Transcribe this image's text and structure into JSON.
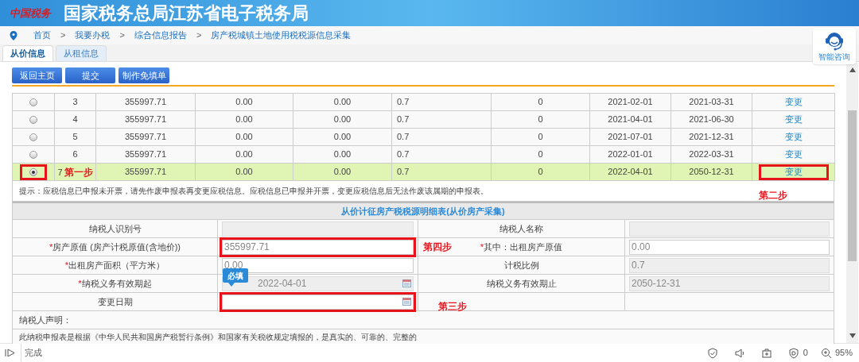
{
  "header": {
    "logo_text": "中国税务",
    "title": "国家税务总局江苏省电子税务局"
  },
  "breadcrumb": [
    {
      "kind": "link",
      "text": "首页"
    },
    {
      "kind": "separator",
      "text": ">"
    },
    {
      "kind": "link",
      "text": "我要办税"
    },
    {
      "kind": "separator",
      "text": ">"
    },
    {
      "kind": "link",
      "text": "综合信息报告"
    },
    {
      "kind": "separator",
      "text": ">"
    },
    {
      "kind": "link",
      "text": "房产税城镇土地使用税税源信息采集"
    }
  ],
  "help": {
    "label": "智能咨询"
  },
  "tabs": [
    {
      "label": "从价信息",
      "selected": true
    },
    {
      "label": "从租信息",
      "selected": false
    }
  ],
  "buttons": [
    "返回主页",
    "提交",
    "制作免填单"
  ],
  "table": {
    "rows": [
      {
        "selected": false,
        "radio_boxed": false,
        "action_boxed": false,
        "cells": [
          "3",
          "355997.71",
          "0.00",
          "0.00",
          "0.7",
          "0",
          "2021-02-01",
          "2021-03-31"
        ],
        "action": "变更"
      },
      {
        "selected": false,
        "radio_boxed": false,
        "action_boxed": false,
        "cells": [
          "4",
          "355997.71",
          "0.00",
          "0.00",
          "0.7",
          "0",
          "2021-04-01",
          "2021-06-30"
        ],
        "action": "变更"
      },
      {
        "selected": false,
        "radio_boxed": false,
        "action_boxed": false,
        "cells": [
          "5",
          "355997.71",
          "0.00",
          "0.00",
          "0.7",
          "0",
          "2021-07-01",
          "2021-12-31"
        ],
        "action": "变更"
      },
      {
        "selected": false,
        "radio_boxed": false,
        "action_boxed": false,
        "cells": [
          "6",
          "355997.71",
          "0.00",
          "0.00",
          "0.7",
          "0",
          "2022-01-01",
          "2022-03-31"
        ],
        "action": "变更"
      },
      {
        "selected": true,
        "radio_boxed": true,
        "action_boxed": true,
        "cells": [
          "7",
          "355997.71",
          "0.00",
          "0.00",
          "0.7",
          "0",
          "2022-04-01",
          "2050-12-31"
        ],
        "action": "变更",
        "step_note": "第一步"
      }
    ],
    "hint": "提示：应税信息已申报未开票，请先作废申报表再变更应税信息。应税信息已申报并开票，变更应税信息后无法作废该属期的申报表。",
    "hint_step": "第二步"
  },
  "form": {
    "title": "从价计征房产税税源明细表(从价房产采集)",
    "rows": [
      [
        {
          "label": "纳税人识别号",
          "readonly": true,
          "boxed": false,
          "kind": "text"
        },
        {
          "label": "纳税人名称",
          "readonly": true,
          "boxed": false,
          "kind": "text"
        }
      ],
      [
        {
          "required_mark": "*",
          "label": "房产原值 (房产计税原值(含地价))",
          "readonly": false,
          "boxed": true,
          "kind": "text",
          "value": "355997.71"
        },
        {
          "required_mark": "*",
          "label": "其中：出租房产原值",
          "readonly": false,
          "boxed": false,
          "kind": "text",
          "value": "0.00",
          "step_note": "第四步"
        }
      ],
      [
        {
          "required_mark": "*",
          "label": "出租房产面积（平方米）",
          "readonly": false,
          "boxed": false,
          "kind": "text",
          "value": "0.00"
        },
        {
          "label": "计税比例",
          "readonly": true,
          "boxed": false,
          "kind": "text",
          "value": "0.7"
        }
      ],
      [
        {
          "required_mark": "*",
          "label": "纳税义务有效期起",
          "readonly": true,
          "boxed": false,
          "kind": "date",
          "value": "2022-04-01",
          "tooltip": "必填"
        },
        {
          "label": "纳税义务有效期止",
          "readonly": true,
          "boxed": false,
          "kind": "text",
          "value": "2050-12-31"
        }
      ],
      [
        {
          "label": "变更日期",
          "readonly": false,
          "boxed": true,
          "kind": "date"
        },
        {
          "kind": "none",
          "step_note": "第三步"
        }
      ]
    ]
  },
  "declaration": {
    "label": "纳税人声明：",
    "text": "此纳税申报表是根据《中华人民共和国房产税暂行条例》和国家有关税收规定填报的，是真实的、可靠的、完整的"
  },
  "status_bar": {
    "status": "完成",
    "ad_count": "0",
    "zoom": "95%"
  }
}
